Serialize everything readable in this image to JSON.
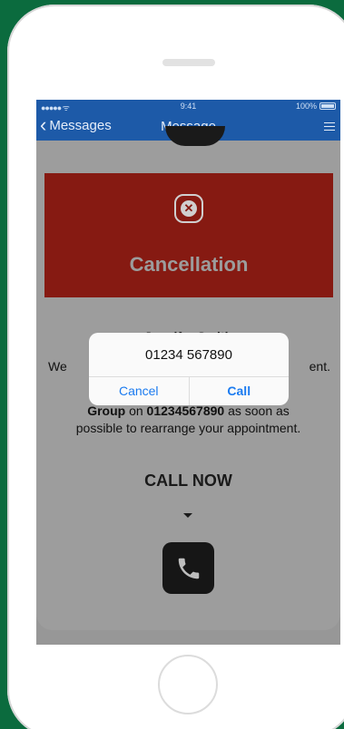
{
  "status": {
    "signal": "●●●●● ᯤ",
    "time": "9:41",
    "battery": "100%"
  },
  "nav": {
    "back_label": "Messages",
    "title": "Message"
  },
  "banner": {
    "title": "Cancellation"
  },
  "message": {
    "name": "Jennifer Smith",
    "line1_left": "We",
    "line1_right": "ent.",
    "line2_bold": "Group",
    "line2_mid": " on ",
    "line2_num": "01234567890",
    "line2_tail": " as soon as",
    "line3": "possible to rearrange your appointment."
  },
  "cta": {
    "label": "CALL NOW"
  },
  "alert": {
    "title": "01234 567890",
    "cancel_label": "Cancel",
    "call_label": "Call"
  },
  "colors": {
    "nav_blue": "#1d5aa8",
    "banner_red": "#861a12",
    "link_blue": "#1b7bf0",
    "frame_green": "#0b6b3e"
  }
}
